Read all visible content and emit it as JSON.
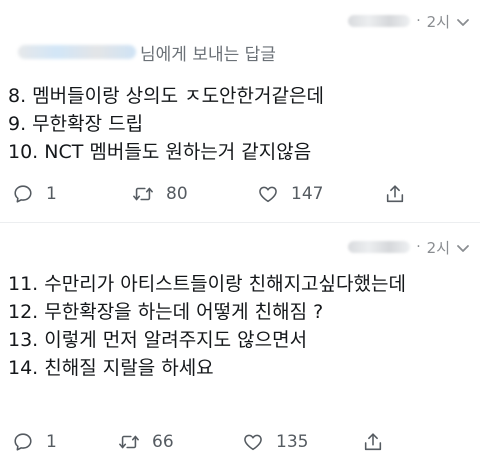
{
  "tweet1": {
    "time": "2시",
    "reply_label": "님에게 보내는 답글",
    "lines": [
      "8. 멤버들이랑 상의도 ㅈ도안한거같은데",
      "9. 무한확장 드립",
      "10. NCT 멤버들도 원하는거 같지않음"
    ],
    "counts": {
      "replies": "1",
      "retweets": "80",
      "likes": "147"
    }
  },
  "tweet2": {
    "time": "2시",
    "lines": [
      "11. 수만리가 아티스트들이랑 친해지고싶다했는데",
      "12. 무한확장을 하는데 어떻게 친해짐 ?",
      "13. 이렇게 먼저 알려주지도 않으면서",
      "14. 친해질 지랄을 하세요"
    ],
    "counts": {
      "replies": "1",
      "retweets": "66",
      "likes": "135"
    }
  },
  "icons": {
    "reply": "speech-bubble-icon",
    "retweet": "retweet-arrows-icon",
    "like": "heart-icon",
    "share": "share-upload-icon",
    "menu": "chevron-down-icon"
  },
  "colors": {
    "text": "#14171a",
    "muted": "#8a8d91",
    "icon": "#555b61"
  }
}
